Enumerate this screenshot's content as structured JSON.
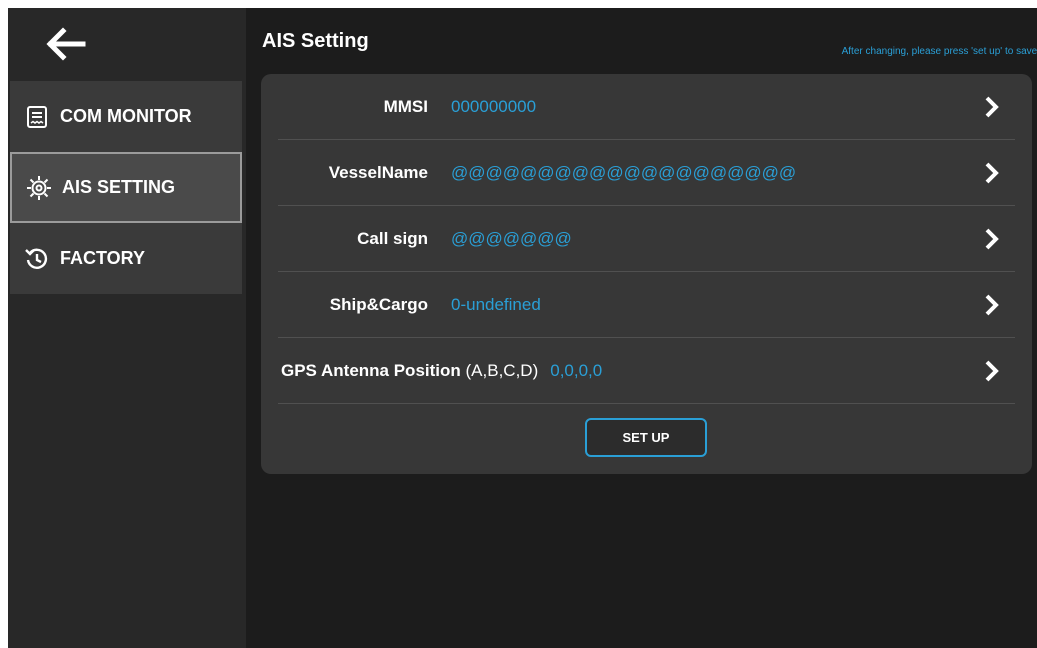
{
  "sidebar": {
    "back_icon": "arrow-left-icon",
    "items": [
      {
        "label": "COM MONITOR",
        "icon": "receipt-icon",
        "active": false
      },
      {
        "label": "AIS SETTING",
        "icon": "gear-icon",
        "active": true
      },
      {
        "label": "FACTORY",
        "icon": "history-icon",
        "active": false
      }
    ]
  },
  "header": {
    "title": "AIS Setting",
    "hint": "After changing, please press 'set up' to save."
  },
  "fields": [
    {
      "label": "MMSI",
      "value": "000000000"
    },
    {
      "label": "VesselName",
      "value": "@@@@@@@@@@@@@@@@@@@@"
    },
    {
      "label": "Call sign",
      "value": "@@@@@@@"
    },
    {
      "label": "Ship&Cargo",
      "value": "0-undefined"
    },
    {
      "label": "GPS Antenna Position",
      "label_suffix": "(A,B,C,D)",
      "value": "0,0,0,0"
    }
  ],
  "setup_button": {
    "label": "SET UP"
  },
  "colors": {
    "accent": "#2a9fd6",
    "background": "#1c1c1c",
    "sidebar": "#282828",
    "panel": "#373737"
  }
}
